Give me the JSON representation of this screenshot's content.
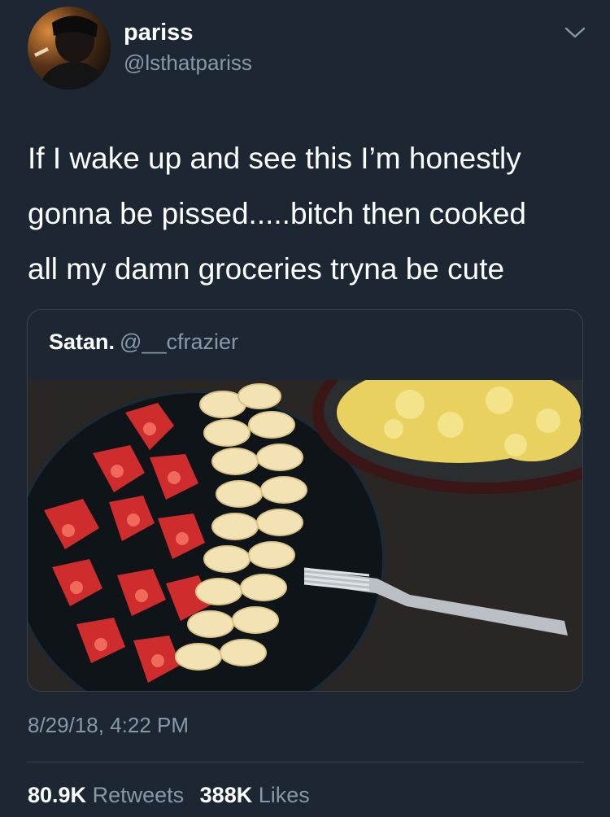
{
  "author": {
    "display_name": "pariss",
    "handle": "@lsthatpariss"
  },
  "tweet": {
    "text_lines": [
      "If I wake up and see this I’m honestly",
      "gonna be pissed.....bitch then cooked",
      "all my damn groceries tryna be cute"
    ]
  },
  "quoted_tweet": {
    "display_name": "Satan.",
    "handle": "@__cfrazier",
    "image_icon": "photo-of-strawberries-bananas-and-scrambled-eggs"
  },
  "timestamp": "8/29/18, 4:22 PM",
  "stats": {
    "retweets_count": "80.9K",
    "retweets_label": "Retweets",
    "likes_count": "388K",
    "likes_label": "Likes"
  },
  "colors": {
    "background": "#1c2733",
    "secondary_text": "#8899a6",
    "border": "#38444d"
  }
}
